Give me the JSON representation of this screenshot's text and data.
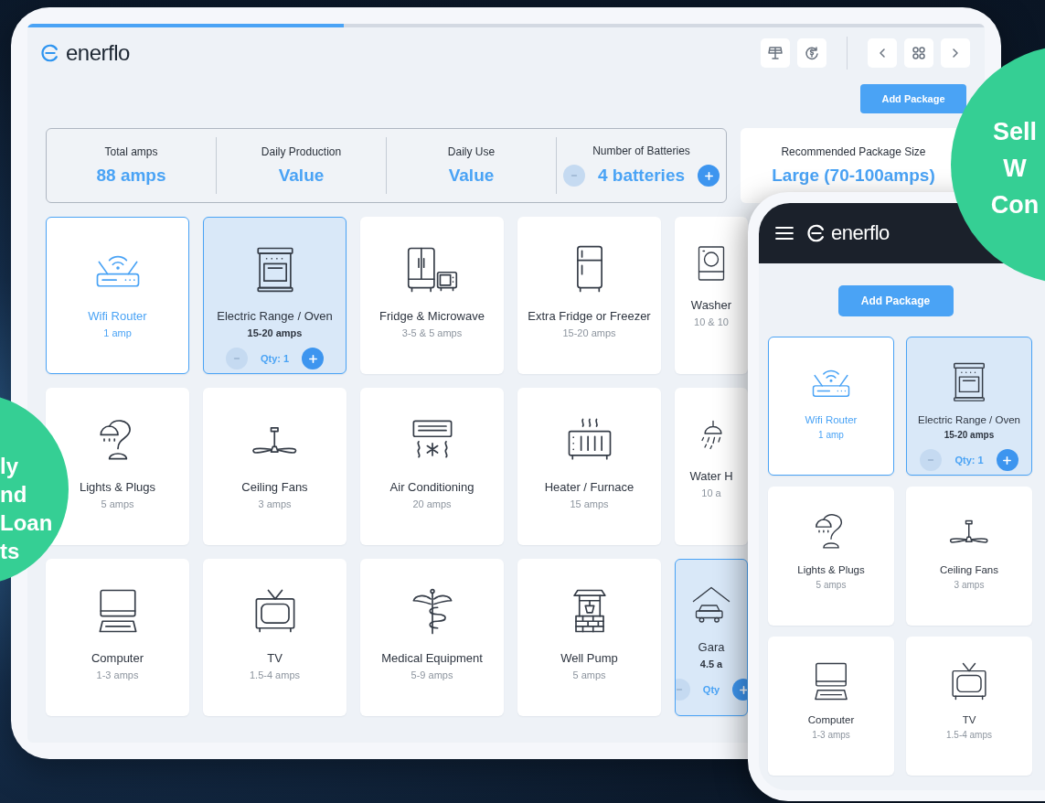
{
  "tablet": {
    "progress": {
      "level": 0.33
    },
    "logo": "enerflo",
    "add_package": "Add Package",
    "stats": [
      {
        "kind": "plain",
        "label": "Total amps",
        "value": "88 amps"
      },
      {
        "kind": "plain",
        "label": "Daily Production",
        "value": "Value"
      },
      {
        "kind": "plain",
        "label": "Daily Use",
        "value": "Value"
      },
      {
        "kind": "stepper",
        "label": "Number of Batteries",
        "value": "4 batteries"
      }
    ],
    "recommended": {
      "label": "Recommended Package Size",
      "value": "Large (70-100amps)"
    },
    "appliances": [
      {
        "name": "Wifi Router",
        "amps": "1 amp",
        "selected": true
      },
      {
        "name": "Electric Range / Oven",
        "amps": "15-20 amps",
        "selected": true,
        "qty": "Qty: 1"
      },
      {
        "name": "Fridge & Microwave",
        "amps": "3-5 & 5 amps",
        "selected": false
      },
      {
        "name": "Extra Fridge or Freezer",
        "amps": "15-20 amps",
        "selected": false
      },
      {
        "name": "Washer",
        "amps": "10 & 10",
        "selected": false
      },
      {
        "name": "Lights & Plugs",
        "amps": "5 amps",
        "selected": false
      },
      {
        "name": "Ceiling Fans",
        "amps": "3 amps",
        "selected": false
      },
      {
        "name": "Air Conditioning",
        "amps": "20 amps",
        "selected": false
      },
      {
        "name": "Heater / Furnace",
        "amps": "15 amps",
        "selected": false
      },
      {
        "name": "Water H",
        "amps": "10 a",
        "selected": false
      },
      {
        "name": "Computer",
        "amps": "1-3 amps",
        "selected": false
      },
      {
        "name": "TV",
        "amps": "1.5-4 amps",
        "selected": false
      },
      {
        "name": "Medical Equipment",
        "amps": "5-9 amps",
        "selected": false
      },
      {
        "name": "Well Pump",
        "amps": "5 amps",
        "selected": false
      },
      {
        "name": "Gara",
        "amps": "4.5 a",
        "selected": true,
        "qty": "Qty"
      }
    ]
  },
  "phone": {
    "logo": "enerflo",
    "add_package": "Add Package",
    "appliances": [
      {
        "name": "Wifi Router",
        "amps": "1 amp",
        "selected": true
      },
      {
        "name": "Electric Range / Oven",
        "amps": "15-20 amps",
        "selected": true,
        "qty": "Qty: 1"
      },
      {
        "name": "Lights & Plugs",
        "amps": "5 amps",
        "selected": false
      },
      {
        "name": "Ceiling Fans",
        "amps": "3 amps",
        "selected": false
      },
      {
        "name": "Computer",
        "amps": "1-3 amps",
        "selected": false
      },
      {
        "name": "TV",
        "amps": "1.5-4 amps",
        "selected": false
      }
    ]
  },
  "callouts": [
    {
      "lines": [
        "ly",
        "nd",
        "Loan",
        "ts"
      ]
    },
    {
      "lines": [
        "Sell",
        "W",
        "Con"
      ]
    }
  ]
}
